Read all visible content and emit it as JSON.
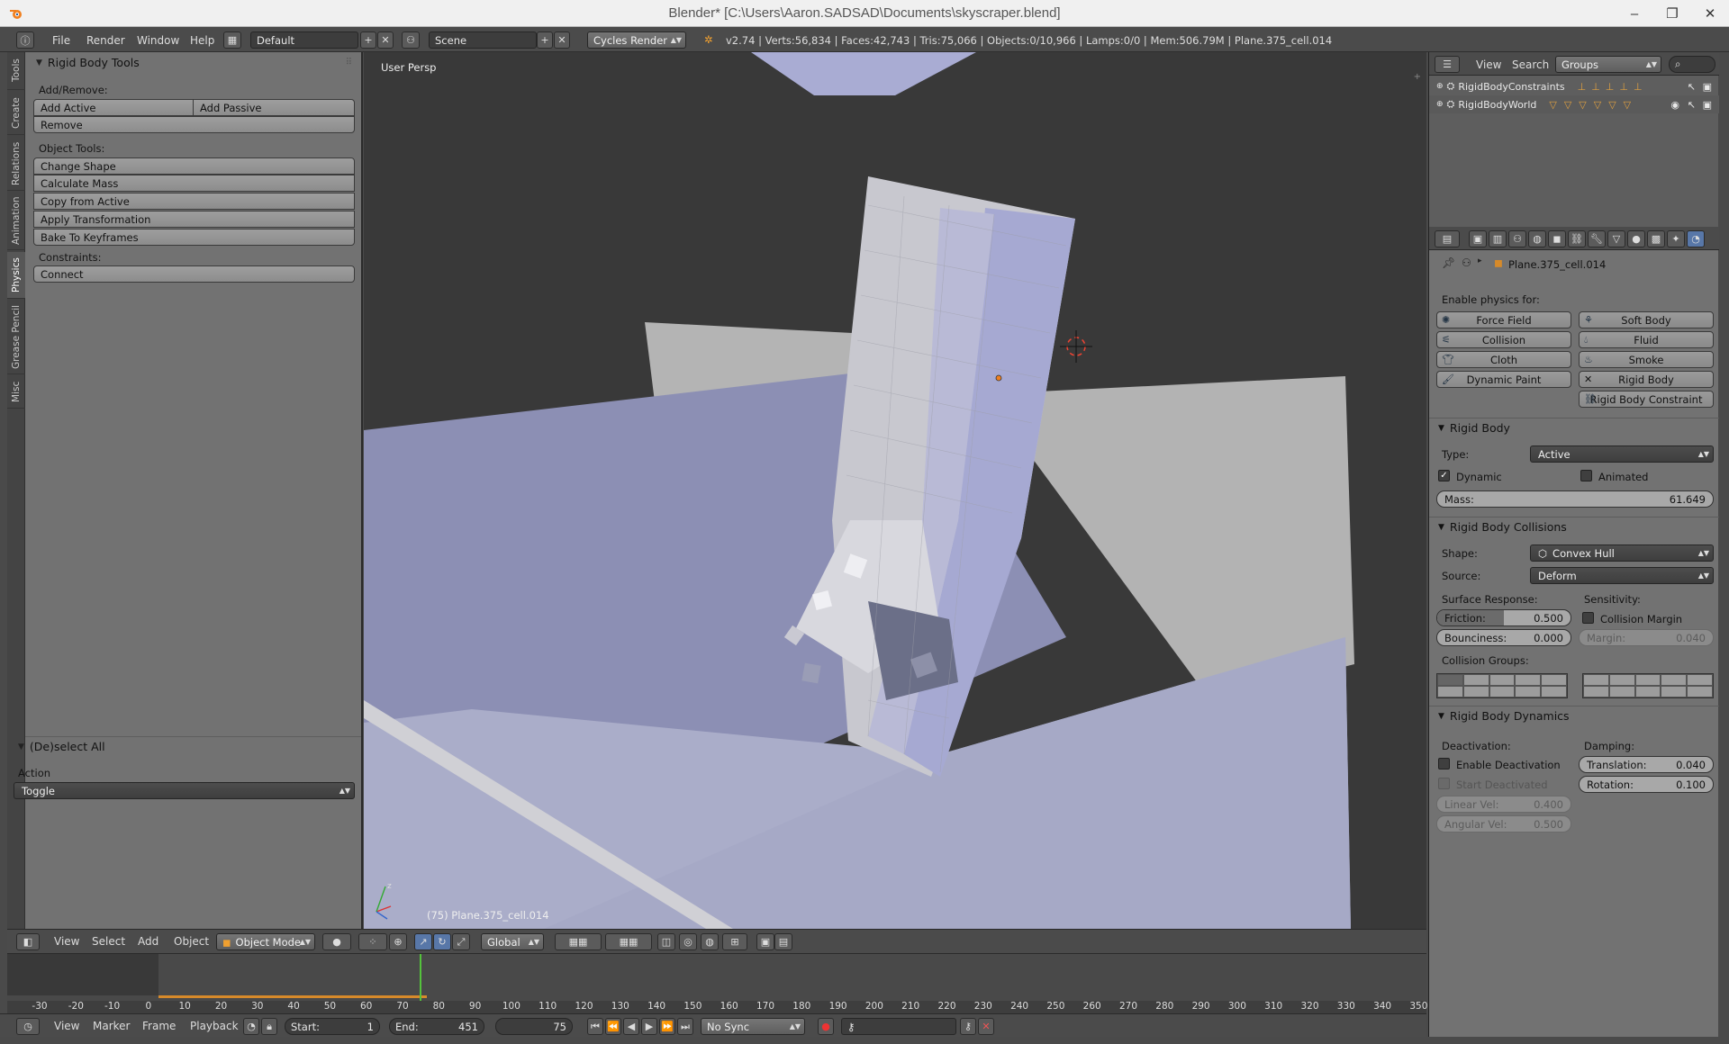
{
  "window": {
    "title": "Blender* [C:\\Users\\Aaron.SADSAD\\Documents\\skyscraper.blend]",
    "controls": [
      "–",
      "❐",
      "✕"
    ]
  },
  "info": {
    "menus": [
      "File",
      "Render",
      "Window",
      "Help"
    ],
    "layout": "Default",
    "scene": "Scene",
    "engine": "Cycles Render",
    "stats": "v2.74 | Verts:56,834 | Faces:42,743 | Tris:75,066 | Objects:0/10,966 | Lamps:0/0 | Mem:506.79M | Plane.375_cell.014"
  },
  "tabs": [
    "Tools",
    "Create",
    "Relations",
    "Animation",
    "Physics",
    "Grease Pencil",
    "Misc"
  ],
  "active_tab": "Physics",
  "rigid_tools": {
    "title": "Rigid Body Tools",
    "add_remove_label": "Add/Remove:",
    "add_active": "Add Active",
    "add_passive": "Add Passive",
    "remove": "Remove",
    "object_tools_label": "Object Tools:",
    "object_tools": [
      "Change Shape",
      "Calculate Mass",
      "Copy from Active",
      "Apply Transformation",
      "Bake To Keyframes"
    ],
    "constraints_label": "Constraints:",
    "connect": "Connect"
  },
  "deselect": {
    "title": "(De)select All",
    "action_label": "Action",
    "action_value": "Toggle"
  },
  "viewport": {
    "view_label": "User Persp",
    "object_label": "(75) Plane.375_cell.014"
  },
  "view_header": {
    "menus": [
      "View",
      "Select",
      "Add",
      "Object"
    ],
    "mode": "Object Mode",
    "orientation": "Global"
  },
  "timeline": {
    "ticks": [
      "-30",
      "-20",
      "-10",
      "0",
      "10",
      "20",
      "30",
      "40",
      "50",
      "60",
      "70",
      "80",
      "90",
      "100",
      "110",
      "120",
      "130",
      "140",
      "150",
      "160",
      "170",
      "180",
      "190",
      "200",
      "210",
      "220",
      "230",
      "240",
      "250",
      "260",
      "270",
      "280",
      "290",
      "300",
      "310",
      "320",
      "330",
      "340",
      "350"
    ],
    "current_frame": 75,
    "menus": [
      "View",
      "Marker",
      "Frame",
      "Playback"
    ],
    "start_label": "Start:",
    "start": "1",
    "end_label": "End:",
    "end": "451",
    "frame": "75",
    "sync": "No Sync"
  },
  "outliner": {
    "menus": [
      "View",
      "Search"
    ],
    "display": "Groups",
    "rows": [
      "RigidBodyConstraints",
      "RigidBodyWorld"
    ]
  },
  "properties": {
    "object": "Plane.375_cell.014",
    "enable_label": "Enable physics for:",
    "physics_buttons": [
      {
        "label": "Force Field",
        "icon": "force-field-icon"
      },
      {
        "label": "Soft Body",
        "icon": "soft-body-icon"
      },
      {
        "label": "Collision",
        "icon": "collision-icon"
      },
      {
        "label": "Fluid",
        "icon": "fluid-icon"
      },
      {
        "label": "Cloth",
        "icon": "cloth-icon"
      },
      {
        "label": "Smoke",
        "icon": "smoke-icon"
      },
      {
        "label": "Dynamic Paint",
        "icon": "dynamic-paint-icon"
      },
      {
        "label": "Rigid Body",
        "icon": "close-icon"
      },
      {
        "label": "Rigid Body Constraint",
        "icon": "link-icon"
      }
    ],
    "rigid_body": {
      "title": "Rigid Body",
      "type_label": "Type:",
      "type": "Active",
      "dynamic": "Dynamic",
      "animated": "Animated",
      "mass_label": "Mass:",
      "mass": "61.649"
    },
    "collisions": {
      "title": "Rigid Body Collisions",
      "shape_label": "Shape:",
      "shape": "Convex Hull",
      "source_label": "Source:",
      "source": "Deform",
      "surface_label": "Surface Response:",
      "sensitivity_label": "Sensitivity:",
      "friction_label": "Friction:",
      "friction": "0.500",
      "friction_fraction": 0.5,
      "bounciness_label": "Bounciness:",
      "bounciness": "0.000",
      "collision_margin": "Collision Margin",
      "margin_label": "Margin:",
      "margin": "0.040",
      "groups_label": "Collision Groups:"
    },
    "dynamics": {
      "title": "Rigid Body Dynamics",
      "deactivation_label": "Deactivation:",
      "damping_label": "Damping:",
      "enable_deactivation": "Enable Deactivation",
      "start_deactivated": "Start Deactivated",
      "translation_label": "Translation:",
      "translation": "0.040",
      "rotation_label": "Rotation:",
      "rotation": "0.100",
      "linear_label": "Linear Vel:",
      "linear": "0.400",
      "angular_label": "Angular Vel:",
      "angular": "0.500"
    }
  }
}
